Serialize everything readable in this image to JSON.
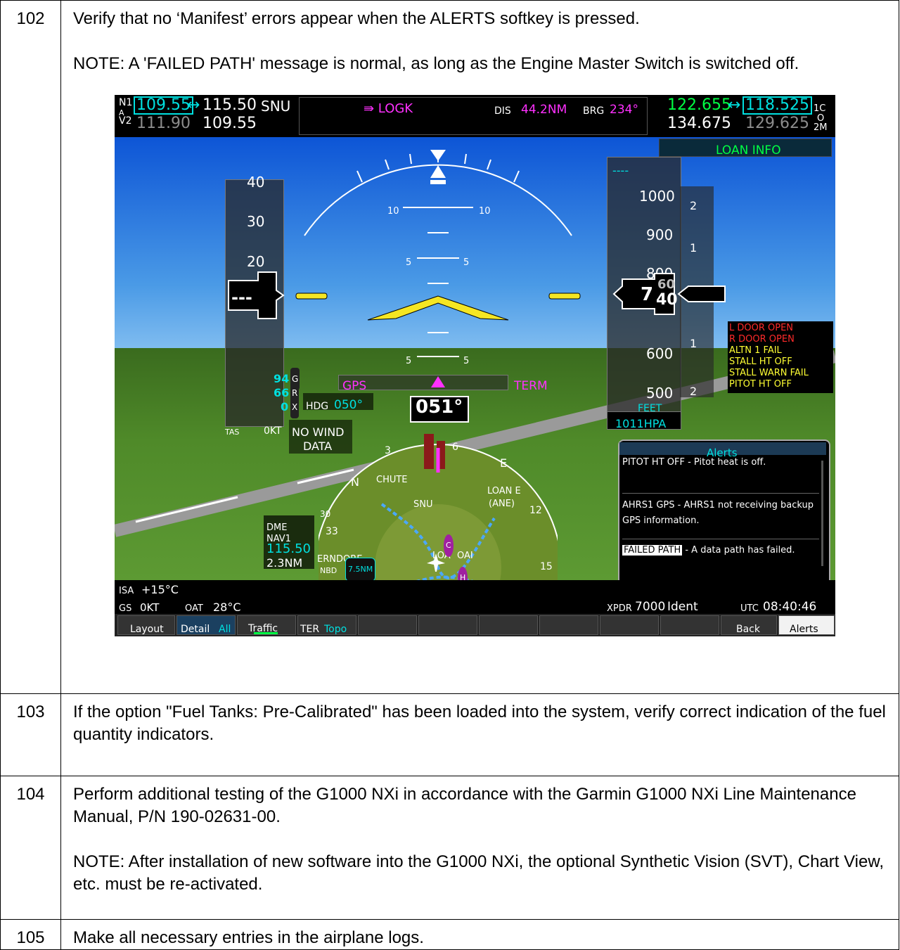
{
  "steps": [
    {
      "num": "102",
      "lines": [
        "Verify that no ‘Manifest’ errors appear when the ALERTS softkey is pressed.",
        "NOTE: A 'FAILED PATH' message is normal, as long as the Engine Master Switch is switched off."
      ]
    },
    {
      "num": "103",
      "lines": [
        "If the option \"Fuel Tanks: Pre-Calibrated\" has been loaded into the system, verify correct indication of the fuel quantity indicators."
      ]
    },
    {
      "num": "104",
      "lines": [
        "Perform additional testing of the G1000 NXi in accordance with the Garmin G1000 NXi Line Maintenance Manual, P/N 190-02631-00.",
        "NOTE: After installation of new software into the G1000 NXi, the optional Synthetic Vision (SVT), Chart View, etc. must be re-activated."
      ]
    },
    {
      "num": "105",
      "lines": [
        "Make all necessary entries in the airplane logs."
      ]
    }
  ],
  "pfd": {
    "nav": {
      "n1_label": "N1",
      "active": "109.55",
      "standby": "115.50",
      "ident": "SNU",
      "n2_label": "V2",
      "nav2_active": "111.90",
      "nav2_standby": "109.55",
      "av_label": "A"
    },
    "dest": {
      "wpt": "⇛ LOGK",
      "dis_label": "DIS",
      "dis": "44.2NM",
      "brg_label": "BRG",
      "brg": "234°"
    },
    "com": {
      "active": "122.655",
      "standby": "118.525",
      "com2_active": "134.675",
      "com2_standby": "129.625",
      "c1": "1C",
      "c2": "2M",
      "o": "O"
    },
    "loan_info": "LOAN INFO",
    "pitch": {
      "p10": "10",
      "p5": "5"
    },
    "airspeed": {
      "t40": "40",
      "t30": "30",
      "t20": "20",
      "readout": "---",
      "tas_label": "TAS",
      "tas": "0KT"
    },
    "altitude": {
      "bug": "----",
      "t1000": "1000",
      "t900": "900",
      "t800": "800",
      "t600": "600",
      "t500": "500",
      "readout_main": "7",
      "readout_tens": "40",
      "readout_up": "60",
      "units": "FEET",
      "baro": "1011HPA",
      "vs_2up": "2",
      "vs_1up": "1",
      "vs_1dn": "1",
      "vs_2dn": "2"
    },
    "cas": [
      {
        "text": "L DOOR OPEN",
        "color": "#ff2a2a"
      },
      {
        "text": "R DOOR OPEN",
        "color": "#ff2a2a"
      },
      {
        "text": "ALTN 1 FAIL",
        "color": "#ffff33"
      },
      {
        "text": "STALL HT OFF",
        "color": "#ffff33"
      },
      {
        "text": "STALL WARN FAIL",
        "color": "#ffff33"
      },
      {
        "text": "PITOT HT OFF",
        "color": "#ffff33"
      }
    ],
    "gs": {
      "g_val": "94",
      "g": "G",
      "r_val": "66",
      "r": "R",
      "x_val": "0",
      "x": "X"
    },
    "cdi": {
      "gps": "GPS",
      "term": "TERM"
    },
    "hdg": {
      "label": "HDG",
      "value": "050°",
      "heading": "051°"
    },
    "wind": {
      "line1": "NO WIND",
      "line2": "DATA"
    },
    "dme": {
      "label": "DME",
      "source": "NAV1",
      "freq": "115.50",
      "dist": "2.3NM"
    },
    "map": {
      "chute": "CHUTE",
      "snu": "SNU",
      "loan": "LOAN E",
      "ane": "(ANE)",
      "loa": "LOA",
      "oai": "OAI",
      "erndore": "ERNDORE",
      "nbd": "NBD",
      "range": "7.5NM",
      "n": "N",
      "e": "E",
      "c": "C",
      "h": "H",
      "d3": "3",
      "d6": "6",
      "d12": "12",
      "d15": "15",
      "d33": "33",
      "d30": "30"
    },
    "alerts": {
      "title": "Alerts",
      "items": [
        {
          "tag": "PITOT HT OFF",
          "text": " - Pitot heat is off."
        },
        {
          "tag": "AHRS1 GPS",
          "text": " - AHRS1 not receiving backup GPS information."
        },
        {
          "tag": "FAILED PATH",
          "text": " - A data path has failed."
        }
      ]
    },
    "temps": {
      "isa_label": "ISA",
      "isa": "+15°C",
      "gs_label": "GS",
      "gs": "0KT",
      "oat_label": "OAT",
      "oat": "28°C"
    },
    "xpdr": {
      "label": "XPDR",
      "code": "7000",
      "mode": "Ident",
      "utc_label": "UTC",
      "utc": "08:40:46"
    },
    "softkeys": [
      "Layout",
      "Detail",
      "All",
      "Traffic",
      "TER",
      "Topo",
      "Back",
      "Alerts"
    ]
  }
}
